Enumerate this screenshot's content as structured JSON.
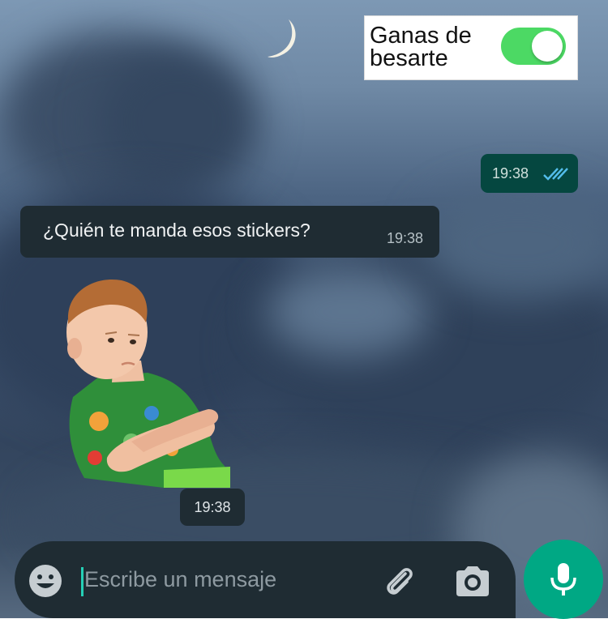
{
  "toggle": {
    "label_line1": "Ganas de",
    "label_line2": "besarte",
    "state": "on",
    "color": "#4cd964"
  },
  "messages": {
    "outgoing": {
      "time": "19:38",
      "status_icon": "double-check-icon"
    },
    "incoming": {
      "text": "¿Quién te manda esos stickers?",
      "time": "19:38"
    },
    "sticker": {
      "time": "19:38",
      "description_icon": "sticker-boy-arms-crossed"
    }
  },
  "composer": {
    "placeholder": "Escribe un mensaje",
    "icons": [
      "emoji-icon",
      "attach-icon",
      "camera-icon",
      "mic-icon"
    ],
    "accent": "#00a884"
  }
}
